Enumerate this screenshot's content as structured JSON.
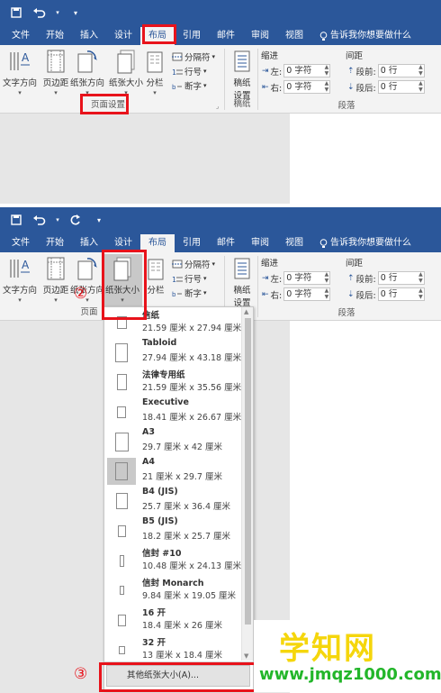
{
  "colors": {
    "ribbon_blue": "#2b579a",
    "highlight_red": "#e8131b",
    "watermark_yellow": "#f5d60c",
    "watermark_green": "#23b62a"
  },
  "tabs": [
    {
      "label": "文件"
    },
    {
      "label": "开始"
    },
    {
      "label": "插入"
    },
    {
      "label": "设计"
    },
    {
      "label": "布局"
    },
    {
      "label": "引用"
    },
    {
      "label": "邮件"
    },
    {
      "label": "审阅"
    },
    {
      "label": "视图"
    }
  ],
  "tell_me": "告诉我你想要做什么",
  "qat_icons": [
    "save-icon",
    "undo-icon",
    "redo-icon",
    "customize-icon"
  ],
  "page_setup": {
    "text_direction": "文字方向",
    "margins": "页边距",
    "orientation": "纸张方向",
    "size": "纸张大小",
    "columns": "分栏",
    "breaks": "分隔符",
    "line_numbers": "行号",
    "hyphenation": "断字",
    "group_label": "页面设置",
    "group_label_clipped": "页面"
  },
  "draft": {
    "label_line1": "稿纸",
    "label_line2": "设置",
    "group_label": "稿纸"
  },
  "paragraph": {
    "indent_title": "缩进",
    "spacing_title": "间距",
    "left_label": "左:",
    "right_label": "右:",
    "before_label": "段前:",
    "after_label": "段后:",
    "left_value": "0 字符",
    "right_value": "0 字符",
    "before_value": "0 行",
    "after_value": "0 行",
    "group_label": "段落"
  },
  "paper_sizes": [
    {
      "name": "信纸",
      "dims": "21.59 厘米 x 27.94 厘米"
    },
    {
      "name": "Tabloid",
      "dims": "27.94 厘米 x 43.18 厘米"
    },
    {
      "name": "法律专用纸",
      "dims": "21.59 厘米 x 35.56 厘米"
    },
    {
      "name": "Executive",
      "dims": "18.41 厘米 x 26.67 厘米"
    },
    {
      "name": "A3",
      "dims": "29.7 厘米 x 42 厘米"
    },
    {
      "name": "A4",
      "dims": "21 厘米 x 29.7 厘米",
      "selected": true
    },
    {
      "name": "B4 (JIS)",
      "dims": "25.7 厘米 x 36.4 厘米"
    },
    {
      "name": "B5 (JIS)",
      "dims": "18.2 厘米 x 25.7 厘米"
    },
    {
      "name": "信封 #10",
      "dims": "10.48 厘米 x 24.13 厘米"
    },
    {
      "name": "信封 Monarch",
      "dims": "9.84 厘米 x 19.05 厘米"
    },
    {
      "name": "16 开",
      "dims": "18.4 厘米 x 26 厘米"
    },
    {
      "name": "32 开",
      "dims": "13 厘米 x 18.4 厘米"
    }
  ],
  "more_sizes": "其他纸张大小(A)...",
  "step_marks": {
    "two": "②",
    "three": "③"
  },
  "watermark": {
    "name": "学知网",
    "url": "www.jmqz1000.com"
  }
}
